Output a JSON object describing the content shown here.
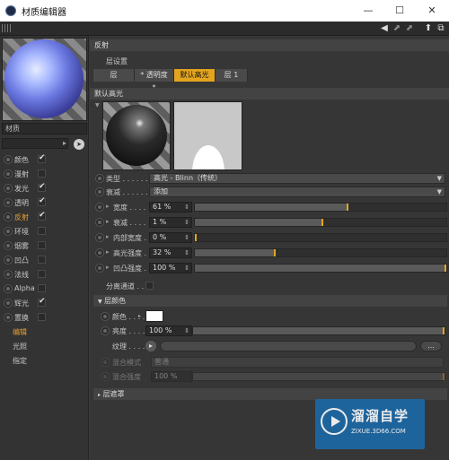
{
  "window": {
    "title": "材质编辑器",
    "min": "—",
    "max": "☐",
    "close": "✕"
  },
  "toolbar": {
    "arrow": "◀",
    "icon1": "⬈",
    "icon2": "⬈",
    "icon3": "⬆",
    "icon4": "⧉"
  },
  "left": {
    "material_name": "材质",
    "channels": [
      {
        "label": "颜色",
        "checked": true,
        "active": false
      },
      {
        "label": "漫射",
        "checked": false,
        "active": false
      },
      {
        "label": "发光",
        "checked": true,
        "active": false
      },
      {
        "label": "透明",
        "checked": true,
        "active": false
      },
      {
        "label": "反射",
        "checked": true,
        "active": true
      },
      {
        "label": "环境",
        "checked": false,
        "active": false
      },
      {
        "label": "烟雾",
        "checked": false,
        "active": false
      },
      {
        "label": "凹凸",
        "checked": false,
        "active": false
      },
      {
        "label": "法线",
        "checked": false,
        "active": false
      },
      {
        "label": "Alpha",
        "checked": false,
        "active": false
      },
      {
        "label": "辉光",
        "checked": true,
        "active": false
      },
      {
        "label": "置换",
        "checked": false,
        "active": false
      }
    ],
    "extras": [
      "编辑",
      "光照",
      "指定"
    ]
  },
  "right": {
    "header": "反射",
    "layer_settings": "层设置",
    "tabs": [
      "层",
      "* 透明度 *",
      "默认高光",
      "层 1"
    ],
    "active_tab": 2,
    "section_title": "默认高光",
    "type_label": "类型",
    "type_value": "高光 - Blinn（传统）",
    "attenuation_label": "衰减",
    "attenuation_value": "添加",
    "params": [
      {
        "label": "宽度",
        "value": "61 %",
        "fill": 61
      },
      {
        "label": "衰减",
        "value": "1 %",
        "fill": 51
      },
      {
        "label": "内部宽度",
        "value": "0 %",
        "fill": 0
      },
      {
        "label": "高光强度",
        "value": "32 %",
        "fill": 32
      },
      {
        "label": "凹凸强度",
        "value": "100 %",
        "fill": 100
      }
    ],
    "separate_pass": "分离通道",
    "layer_color": {
      "title": "层颜色",
      "color_label": "颜色",
      "color_hex": "#ffffff",
      "brightness_label": "亮度",
      "brightness_value": "100 %",
      "brightness_fill": 100,
      "texture_label": "纹理",
      "more": "...",
      "blend_mode_label": "混合模式",
      "blend_mode_value": "普通",
      "blend_strength_label": "混合强度",
      "blend_strength_value": "100 %"
    },
    "layer_mask": "层遮罩"
  },
  "watermark": {
    "brand": "溜溜自学",
    "site": "ZIXUE.3D66.COM"
  }
}
